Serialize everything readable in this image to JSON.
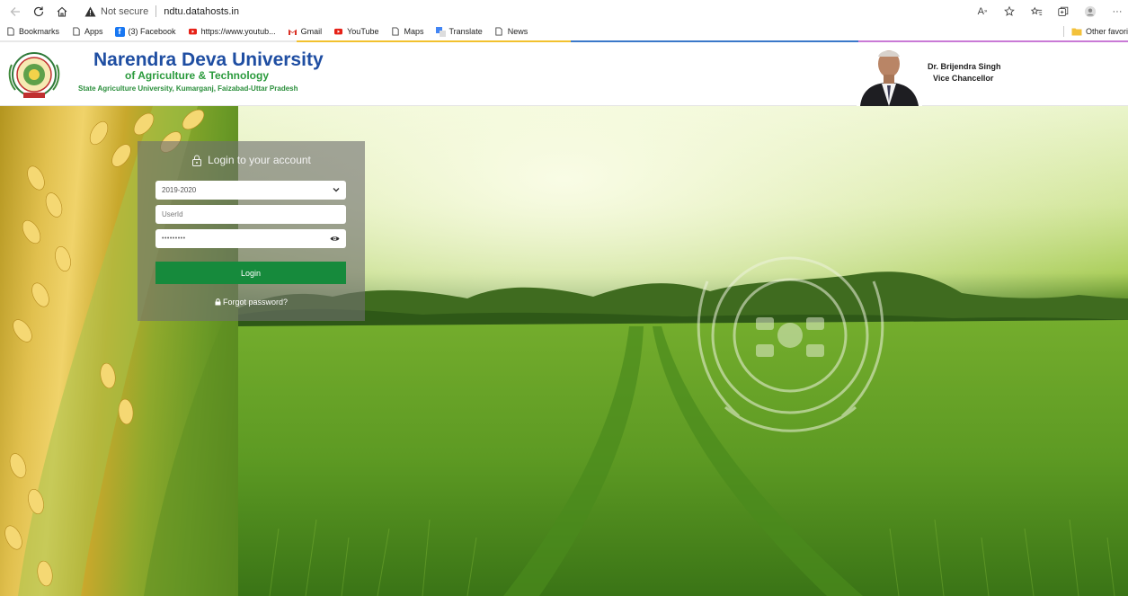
{
  "browser": {
    "not_secure_label": "Not secure",
    "url": "ndtu.datahosts.in",
    "reader_label": "A",
    "bookmarks": [
      {
        "label": "Bookmarks",
        "icon": "page-icon"
      },
      {
        "label": "Apps",
        "icon": "page-icon"
      },
      {
        "label": "(3) Facebook",
        "icon": "facebook-icon"
      },
      {
        "label": "https://www.youtub...",
        "icon": "youtube-icon"
      },
      {
        "label": "Gmail",
        "icon": "gmail-icon"
      },
      {
        "label": "YouTube",
        "icon": "youtube-icon"
      },
      {
        "label": "Maps",
        "icon": "page-icon"
      },
      {
        "label": "Translate",
        "icon": "translate-icon"
      },
      {
        "label": "News",
        "icon": "page-icon"
      }
    ],
    "other_favorites_label": "Other favori"
  },
  "header": {
    "university_name": "Narendra Deva University",
    "subtitle": "of Agriculture & Technology",
    "location": "State Agriculture University, Kumarganj, Faizabad-Uttar Pradesh",
    "vc_name": "Dr. Brijendra Singh",
    "vc_title": "Vice Chancellor"
  },
  "login": {
    "title": "Login to your account",
    "session_value": "2019-2020",
    "userid_placeholder": "UserId",
    "password_value": "•••••••••",
    "login_button": "Login",
    "forgot_label": "Forgot password?"
  },
  "colors": {
    "brand_blue": "#1f4ea2",
    "brand_green": "#2a9a3c",
    "login_button": "#168a3c"
  }
}
